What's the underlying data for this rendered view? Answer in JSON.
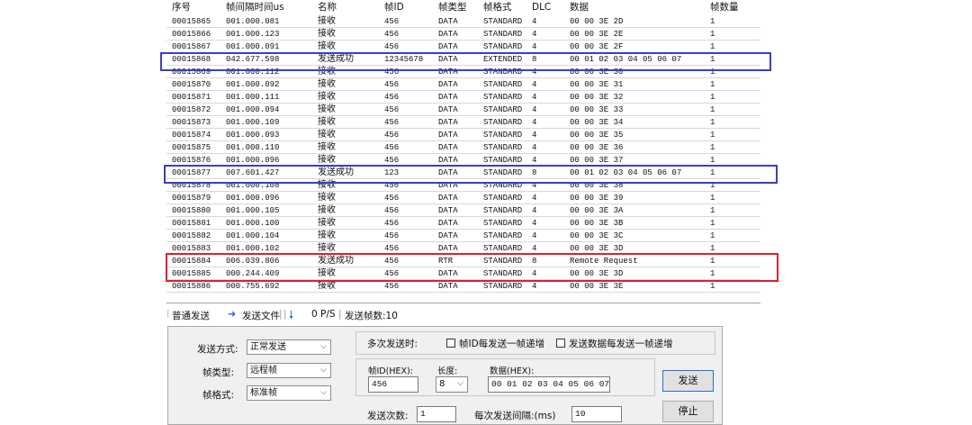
{
  "columns": [
    "序号",
    "帧间隔时间us",
    "名称",
    "帧ID",
    "帧类型",
    "帧格式",
    "DLC",
    "数据",
    "帧数量"
  ],
  "rows": [
    [
      "00015865",
      "001.000.081",
      "接收",
      "456",
      "DATA",
      "STANDARD",
      "4",
      "00 00 3E 2D",
      "1"
    ],
    [
      "00015866",
      "001.000.123",
      "接收",
      "456",
      "DATA",
      "STANDARD",
      "4",
      "00 00 3E 2E",
      "1"
    ],
    [
      "00015867",
      "001.000.091",
      "接收",
      "456",
      "DATA",
      "STANDARD",
      "4",
      "00 00 3E 2F",
      "1"
    ],
    [
      "00015868",
      "042.677.598",
      "发送成功",
      "12345678",
      "DATA",
      "EXTENDED",
      "8",
      "00 01 02 03 04 05 06 07",
      "1"
    ],
    [
      "00015869",
      "001.000.112",
      "接收",
      "456",
      "DATA",
      "STANDARD",
      "4",
      "00 00 3E 30",
      "1"
    ],
    [
      "00015870",
      "001.000.092",
      "接收",
      "456",
      "DATA",
      "STANDARD",
      "4",
      "00 00 3E 31",
      "1"
    ],
    [
      "00015871",
      "001.000.111",
      "接收",
      "456",
      "DATA",
      "STANDARD",
      "4",
      "00 00 3E 32",
      "1"
    ],
    [
      "00015872",
      "001.000.094",
      "接收",
      "456",
      "DATA",
      "STANDARD",
      "4",
      "00 00 3E 33",
      "1"
    ],
    [
      "00015873",
      "001.000.109",
      "接收",
      "456",
      "DATA",
      "STANDARD",
      "4",
      "00 00 3E 34",
      "1"
    ],
    [
      "00015874",
      "001.000.093",
      "接收",
      "456",
      "DATA",
      "STANDARD",
      "4",
      "00 00 3E 35",
      "1"
    ],
    [
      "00015875",
      "001.000.110",
      "接收",
      "456",
      "DATA",
      "STANDARD",
      "4",
      "00 00 3E 36",
      "1"
    ],
    [
      "00015876",
      "001.000.096",
      "接收",
      "456",
      "DATA",
      "STANDARD",
      "4",
      "00 00 3E 37",
      "1"
    ],
    [
      "00015877",
      "007.601.427",
      "发送成功",
      "123",
      "DATA",
      "STANDARD",
      "8",
      "00 01 02 03 04 05 06 07",
      "1"
    ],
    [
      "00015878",
      "001.000.108",
      "接收",
      "456",
      "DATA",
      "STANDARD",
      "4",
      "00 00 3E 38",
      "1"
    ],
    [
      "00015879",
      "001.000.096",
      "接收",
      "456",
      "DATA",
      "STANDARD",
      "4",
      "00 00 3E 39",
      "1"
    ],
    [
      "00015880",
      "001.000.105",
      "接收",
      "456",
      "DATA",
      "STANDARD",
      "4",
      "00 00 3E 3A",
      "1"
    ],
    [
      "00015881",
      "001.000.100",
      "接收",
      "456",
      "DATA",
      "STANDARD",
      "4",
      "00 00 3E 3B",
      "1"
    ],
    [
      "00015882",
      "001.000.104",
      "接收",
      "456",
      "DATA",
      "STANDARD",
      "4",
      "00 00 3E 3C",
      "1"
    ],
    [
      "00015883",
      "001.000.102",
      "接收",
      "456",
      "DATA",
      "STANDARD",
      "4",
      "00 00 3E 3D",
      "1"
    ],
    [
      "00015884",
      "006.039.806",
      "发送成功",
      "456",
      "RTR",
      "STANDARD",
      "8",
      "Remote Request",
      "1"
    ],
    [
      "00015885",
      "000.244.409",
      "接收",
      "456",
      "DATA",
      "STANDARD",
      "4",
      "00 00 3E 3D",
      "1"
    ],
    [
      "00015886",
      "000.755.692",
      "接收",
      "456",
      "DATA",
      "STANDARD",
      "4",
      "00 00 3E 3E",
      "1"
    ]
  ],
  "highlight_colors": {
    "blue": "#3a3fc4",
    "red": "#d9232b"
  },
  "toolbar": {
    "normal_send": "普通发送",
    "send_file": "发送文件",
    "rate": "0 P/S",
    "send_count_label": "发送帧数:10"
  },
  "icons": {
    "send_file": "arrow-right-icon",
    "rate": "arrow-down-icon"
  },
  "form": {
    "send_mode_label": "发送方式:",
    "send_mode_value": "正常发送",
    "frame_type_label": "帧类型:",
    "frame_type_value": "远程帧",
    "frame_format_label": "帧格式:",
    "frame_format_value": "标准帧",
    "multi_send_label": "多次发送时:",
    "id_inc_label": "帧ID每发送一帧递增",
    "data_inc_label": "发送数据每发送一帧递增",
    "frame_id_label": "帧ID(HEX):",
    "frame_id_value": "456",
    "length_label": "长度:",
    "length_value": "8",
    "data_label": "数据(HEX):",
    "data_value": "00 01 02 03 04 05 06 07",
    "send_times_label": "发送次数:",
    "send_times_value": "1",
    "interval_label": "每次发送间隔:(ms)",
    "interval_value": "10",
    "send_button": "发送",
    "stop_button": "停止"
  }
}
